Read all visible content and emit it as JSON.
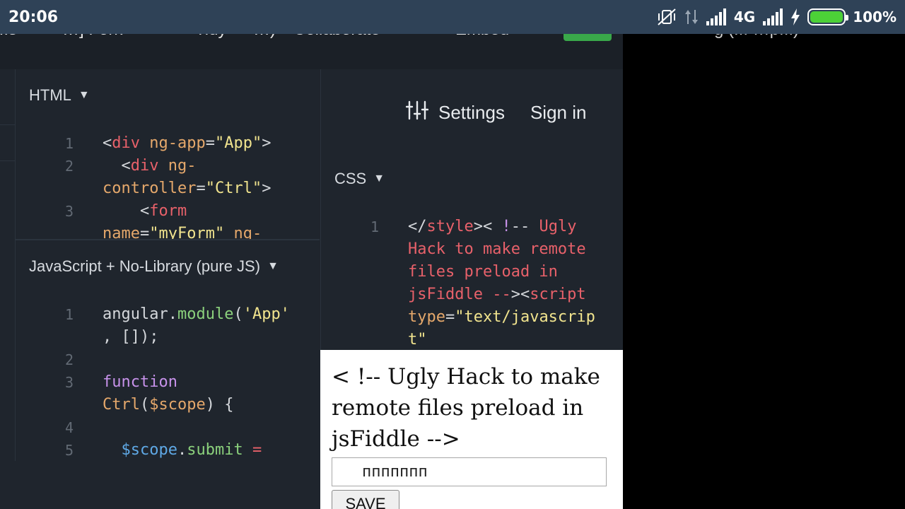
{
  "status_bar": {
    "time": "20:06",
    "network_type": "4G",
    "battery_percent": "100%",
    "battery_level": 1.0,
    "icons": [
      "vibrate-off-icon",
      "data-arrows-icon",
      "signal-icon",
      "signal-icon",
      "charging-bolt-icon",
      "battery-icon"
    ]
  },
  "top_nav": {
    "items": [
      "...s",
      "…] Fork",
      "Tidy",
      "…)",
      "Collaborate",
      "Embed"
    ],
    "right_text": "g (... …p...)"
  },
  "html_panel": {
    "title": "HTML",
    "line_numbers": [
      "1",
      "2",
      "3"
    ]
  },
  "js_panel": {
    "title": "JavaScript + No-Library (pure JS)",
    "line_numbers": [
      "1",
      "2",
      "3",
      "4",
      "5"
    ]
  },
  "css_panel": {
    "settings_label": "Settings",
    "sign_in_label": "Sign in",
    "title": "CSS",
    "line_numbers": [
      "1"
    ]
  },
  "result": {
    "hack_text": "< !-- Ugly Hack to make remote files preload in jsFiddle -->",
    "input_value": "ппппппп",
    "save_label": "SAVE"
  },
  "colors": {
    "status_bar_bg": "#2f4257",
    "editor_bg": "#1f252d",
    "run_button": "#39a84a",
    "battery_fill": "#4cd137"
  }
}
